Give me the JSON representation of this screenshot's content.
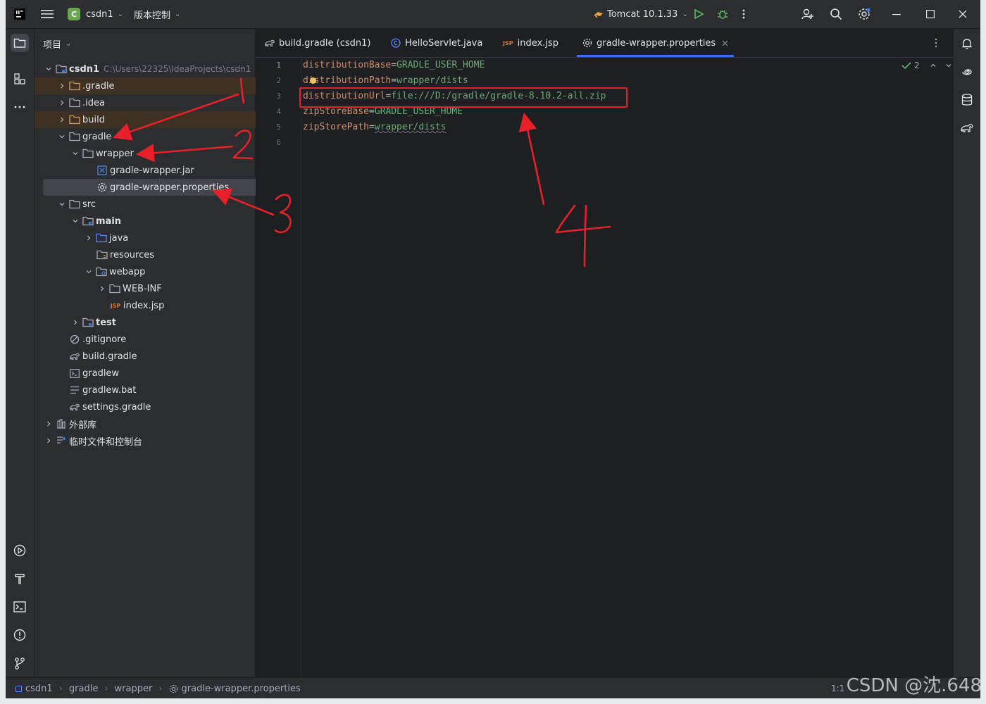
{
  "titlebar": {
    "project_badge": "C",
    "project_name": "csdn1",
    "vcs_label": "版本控制",
    "run_config": "Tomcat 10.1.33"
  },
  "project_panel": {
    "title": "项目",
    "root": {
      "label": "csdn1",
      "path": "C:\\Users\\22325\\IdeaProjects\\csdn1"
    },
    "items": [
      {
        "label": ".gradle"
      },
      {
        "label": ".idea"
      },
      {
        "label": "build"
      },
      {
        "label": "gradle"
      },
      {
        "label": "wrapper"
      },
      {
        "label": "gradle-wrapper.jar"
      },
      {
        "label": "gradle-wrapper.properties"
      },
      {
        "label": "src"
      },
      {
        "label": "main"
      },
      {
        "label": "java"
      },
      {
        "label": "resources"
      },
      {
        "label": "webapp"
      },
      {
        "label": "WEB-INF"
      },
      {
        "label": "index.jsp"
      },
      {
        "label": "test"
      },
      {
        "label": ".gitignore"
      },
      {
        "label": "build.gradle"
      },
      {
        "label": "gradlew"
      },
      {
        "label": "gradlew.bat"
      },
      {
        "label": "settings.gradle"
      },
      {
        "label": "外部库"
      },
      {
        "label": "临时文件和控制台"
      }
    ]
  },
  "editor": {
    "tabs": [
      {
        "label": "build.gradle (csdn1)"
      },
      {
        "label": "HelloServlet.java"
      },
      {
        "label": "index.jsp"
      },
      {
        "label": "gradle-wrapper.properties"
      }
    ],
    "jsp_badge": "JSP",
    "inspection_count": "2",
    "line_numbers": [
      "1",
      "2",
      "3",
      "4",
      "5",
      "6"
    ],
    "lines": [
      {
        "key": "distributionBase",
        "value": "GRADLE_USER_HOME"
      },
      {
        "key": "distributionPath",
        "value": "wrapper/dists"
      },
      {
        "key": "distributionUrl",
        "value": "file:///D:/gradle/gradle-8.10.2-all.zip"
      },
      {
        "key": "zipStoreBase",
        "value": "GRADLE_USER_HOME"
      },
      {
        "key": "zipStorePath",
        "value": "wrapper/dists"
      }
    ],
    "eq": "="
  },
  "statusbar": {
    "breadcrumbs": [
      "csdn1",
      "gradle",
      "wrapper",
      "gradle-wrapper.properties"
    ],
    "position": "1:1"
  },
  "watermark": "CSDN @沈.648",
  "annotation_color": "#e8202a"
}
